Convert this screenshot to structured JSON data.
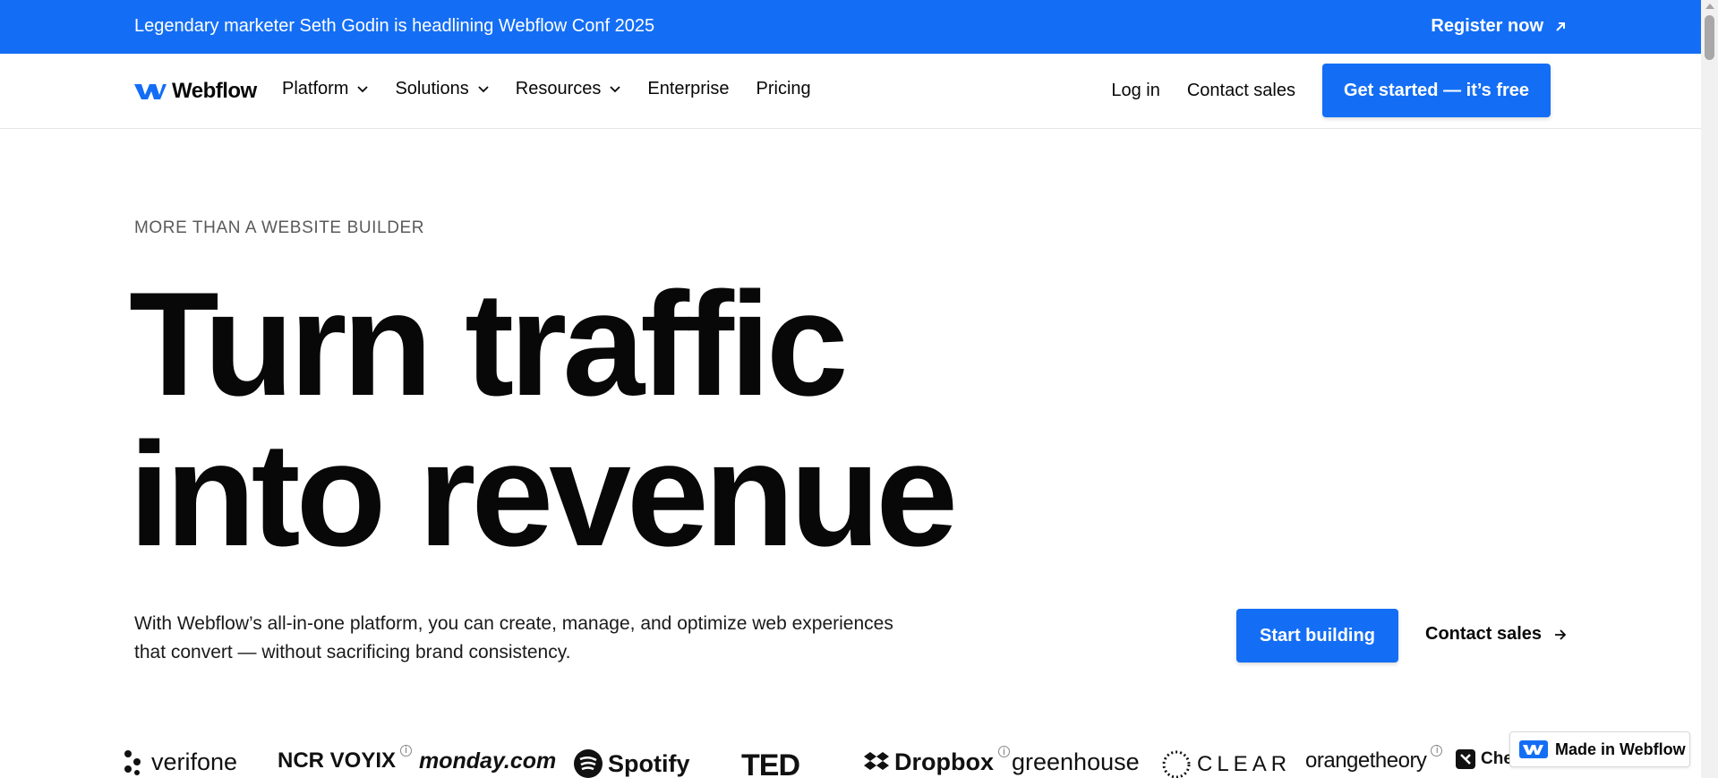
{
  "banner": {
    "text": "Legendary marketer Seth Godin is headlining Webflow Conf 2025",
    "link_label": "Register now",
    "link_icon": "arrow-up-right-icon",
    "background": "#146ef5"
  },
  "nav": {
    "brand": "Webflow",
    "items": [
      {
        "label": "Platform",
        "has_dropdown": true
      },
      {
        "label": "Solutions",
        "has_dropdown": true
      },
      {
        "label": "Resources",
        "has_dropdown": true
      },
      {
        "label": "Enterprise",
        "has_dropdown": false
      },
      {
        "label": "Pricing",
        "has_dropdown": false
      }
    ],
    "login": "Log in",
    "contact": "Contact sales",
    "cta": "Get started — it’s free"
  },
  "hero": {
    "eyebrow": "MORE THAN A WEBSITE BUILDER",
    "headline_line1": "Turn traffic",
    "headline_line2": "into revenue",
    "subcopy": "With Webflow’s all-in-one platform, you can create, manage, and optimize web experiences that convert — without sacrificing brand consistency.",
    "primary_cta": "Start building",
    "secondary_cta": "Contact sales",
    "secondary_icon": "arrow-right-icon"
  },
  "logos": [
    "verifone",
    "NCR VOYIX",
    "monday.com",
    "Spotify",
    "TED",
    "Dropbox",
    "greenhouse",
    "CLEAR",
    "orangetheory",
    "Checkout.com"
  ],
  "badge": {
    "label": "Made in Webflow"
  },
  "colors": {
    "accent": "#146ef5",
    "text": "#080808"
  }
}
